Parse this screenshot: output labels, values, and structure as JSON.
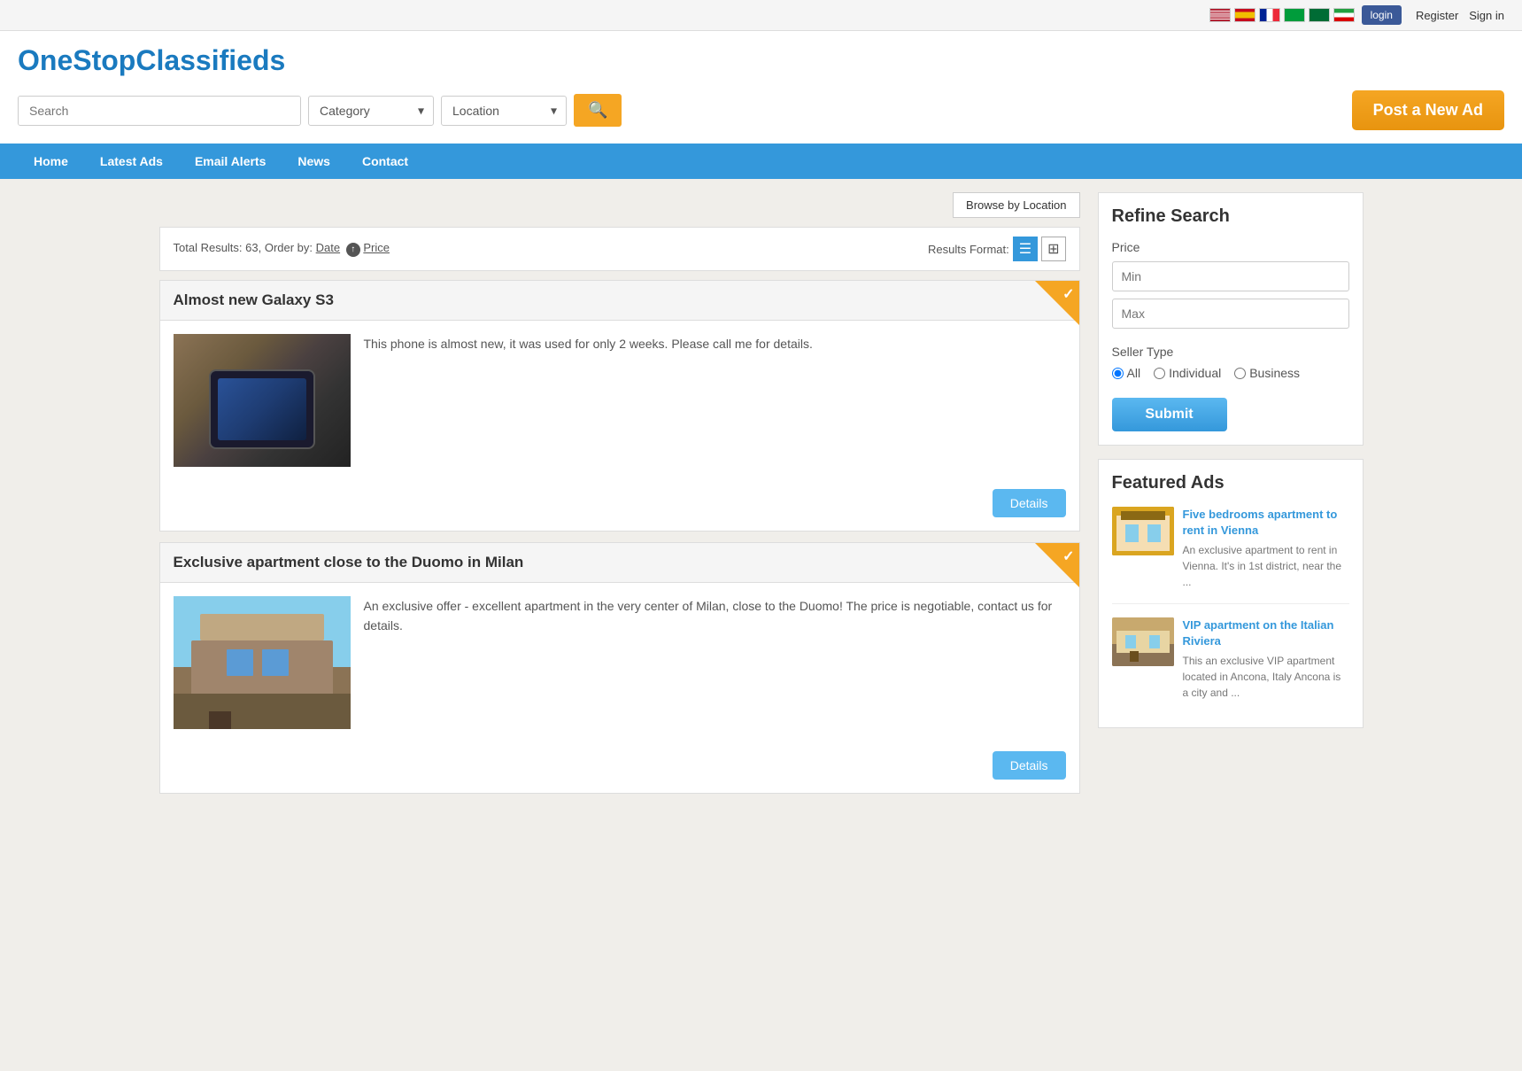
{
  "topbar": {
    "register_label": "Register",
    "signin_label": "Sign in",
    "fb_login_label": "login"
  },
  "header": {
    "site_title": "OneStopClassifieds",
    "search_placeholder": "Search",
    "category_placeholder": "Category",
    "location_placeholder": "Location",
    "post_ad_label": "Post a New Ad"
  },
  "nav": {
    "items": [
      {
        "label": "Home",
        "key": "home"
      },
      {
        "label": "Latest Ads",
        "key": "latest-ads"
      },
      {
        "label": "Email Alerts",
        "key": "email-alerts"
      },
      {
        "label": "News",
        "key": "news"
      },
      {
        "label": "Contact",
        "key": "contact"
      }
    ]
  },
  "browse_location_btn": "Browse by Location",
  "results": {
    "summary": "Total Results: 63, Order by:",
    "order_date": "Date",
    "order_price": "Price",
    "format_label": "Results Format:"
  },
  "ads": [
    {
      "title": "Almost new Galaxy S3",
      "description": "This phone is almost new, it was used for only 2 weeks. Please call me for details.",
      "details_btn": "Details",
      "image_type": "phone"
    },
    {
      "title": "Exclusive apartment close to the Duomo in Milan",
      "description": "An exclusive offer - excellent apartment in the very center of Milan, close to the Duomo! The price is negotiable, contact us for details.",
      "details_btn": "Details",
      "image_type": "apt"
    }
  ],
  "refine_search": {
    "title": "Refine Search",
    "price_label": "Price",
    "min_placeholder": "Min",
    "max_placeholder": "Max",
    "seller_type_label": "Seller Type",
    "seller_options": [
      "All",
      "Individual",
      "Business"
    ],
    "submit_label": "Submit"
  },
  "featured_ads": {
    "title": "Featured Ads",
    "items": [
      {
        "title": "Five bedrooms apartment to rent in Vienna",
        "description": "An exclusive apartment to rent in Vienna. It's in 1st district, near the ...",
        "thumb_type": "vienna"
      },
      {
        "title": "VIP apartment on the Italian Riviera",
        "description": "This an exclusive VIP apartment located in Ancona, Italy Ancona is a city and ...",
        "thumb_type": "riviera"
      }
    ]
  }
}
